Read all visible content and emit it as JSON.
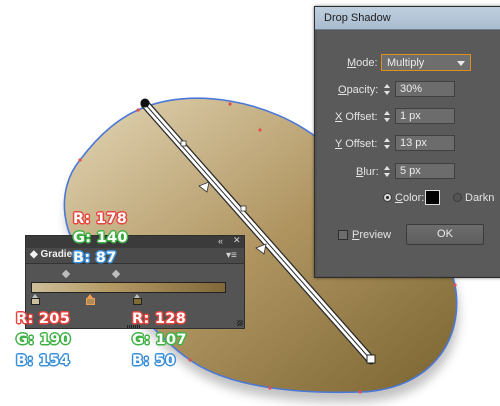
{
  "dialog": {
    "title": "Drop Shadow",
    "mode_label": "Mode:",
    "mode_value": "Multiply",
    "opacity_label": "Opacity:",
    "opacity_value": "30%",
    "x_offset_label": "X Offset:",
    "x_offset_value": "1 px",
    "y_offset_label": "Y Offset:",
    "y_offset_value": "13 px",
    "blur_label": "Blur:",
    "blur_value": "5 px",
    "color_label": "Color:",
    "darkness_label": "Darkn",
    "preview_label": "Preview",
    "ok_label": "OK",
    "shadow_color": "#000000"
  },
  "gradient_panel": {
    "tab_label": "Gradien",
    "collapse_icon": "double-chevron-left-icon",
    "close_icon": "close-icon",
    "menu_icon": "panel-menu-icon"
  },
  "color_labels": {
    "red_color": "#e8443f",
    "green_color": "#3fb144",
    "blue_color": "#3a8fd9",
    "top": {
      "r": "R: 178",
      "g": "G: 140",
      "b": "B: 87"
    },
    "left": {
      "r": "R: 205",
      "g": "G: 190",
      "b": "B: 154"
    },
    "right": {
      "r": "R: 128",
      "g": "G: 107",
      "b": "B: 50"
    }
  },
  "artwork": {
    "blob_fill_light": "#d8c8a4",
    "blob_fill_dark": "#8c753f",
    "selection_color": "#4a78d8"
  }
}
